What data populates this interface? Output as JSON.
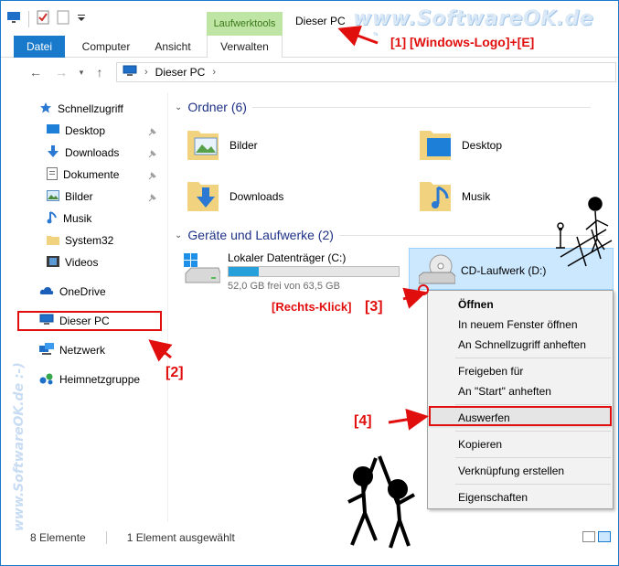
{
  "window": {
    "title": "Dieser PC",
    "context_tab_group": "Laufwerktools"
  },
  "ribbon": {
    "tabs": [
      {
        "label": "Datei"
      },
      {
        "label": "Computer"
      },
      {
        "label": "Ansicht"
      },
      {
        "label": "Verwalten"
      }
    ]
  },
  "address": {
    "path": "Dieser PC"
  },
  "nav": {
    "quick_access": "Schnellzugriff",
    "quick_items": [
      {
        "label": "Desktop",
        "pinned": true
      },
      {
        "label": "Downloads",
        "pinned": true
      },
      {
        "label": "Dokumente",
        "pinned": true
      },
      {
        "label": "Bilder",
        "pinned": true
      },
      {
        "label": "Musik",
        "pinned": false
      },
      {
        "label": "System32",
        "pinned": false
      },
      {
        "label": "Videos",
        "pinned": false
      }
    ],
    "onedrive": "OneDrive",
    "this_pc": "Dieser PC",
    "network": "Netzwerk",
    "homegroup": "Heimnetzgruppe"
  },
  "content": {
    "folders_header": "Ordner (6)",
    "folders": [
      {
        "label": "Bilder",
        "icon": "pictures-folder-icon"
      },
      {
        "label": "Desktop",
        "icon": "desktop-folder-icon"
      },
      {
        "label": "Downloads",
        "icon": "downloads-folder-icon"
      },
      {
        "label": "Musik",
        "icon": "music-folder-icon"
      }
    ],
    "devices_header": "Geräte und Laufwerke (2)",
    "drive_c": {
      "name": "Lokaler Datenträger (C:)",
      "free_text": "52,0 GB frei von 63,5 GB",
      "used_fraction": 0.18
    },
    "drive_d": {
      "name": "CD-Laufwerk (D:)"
    }
  },
  "context_menu": {
    "items": [
      "Öffnen",
      "In neuem Fenster öffnen",
      "An Schnellzugriff anheften",
      "Freigeben für",
      "An \"Start\" anheften",
      "Auswerfen",
      "Kopieren",
      "Verknüpfung erstellen",
      "Eigenschaften"
    ]
  },
  "status": {
    "count": "8 Elemente",
    "selected": "1 Element ausgewählt"
  },
  "annotations": {
    "a1": "[1] [Windows-Logo]+[E]",
    "a2": "[2]",
    "a3_label": "[Rechts-Klick]",
    "a3_num": "[3]",
    "a4": "[4]",
    "watermark": "www.SoftwareOK.de :-)",
    "watermark_vertical": "www.SoftwareOK.de :-)"
  },
  "colors": {
    "accent": "#1979ca",
    "annotation": "#e10e0e",
    "selection": "#cce8ff"
  }
}
